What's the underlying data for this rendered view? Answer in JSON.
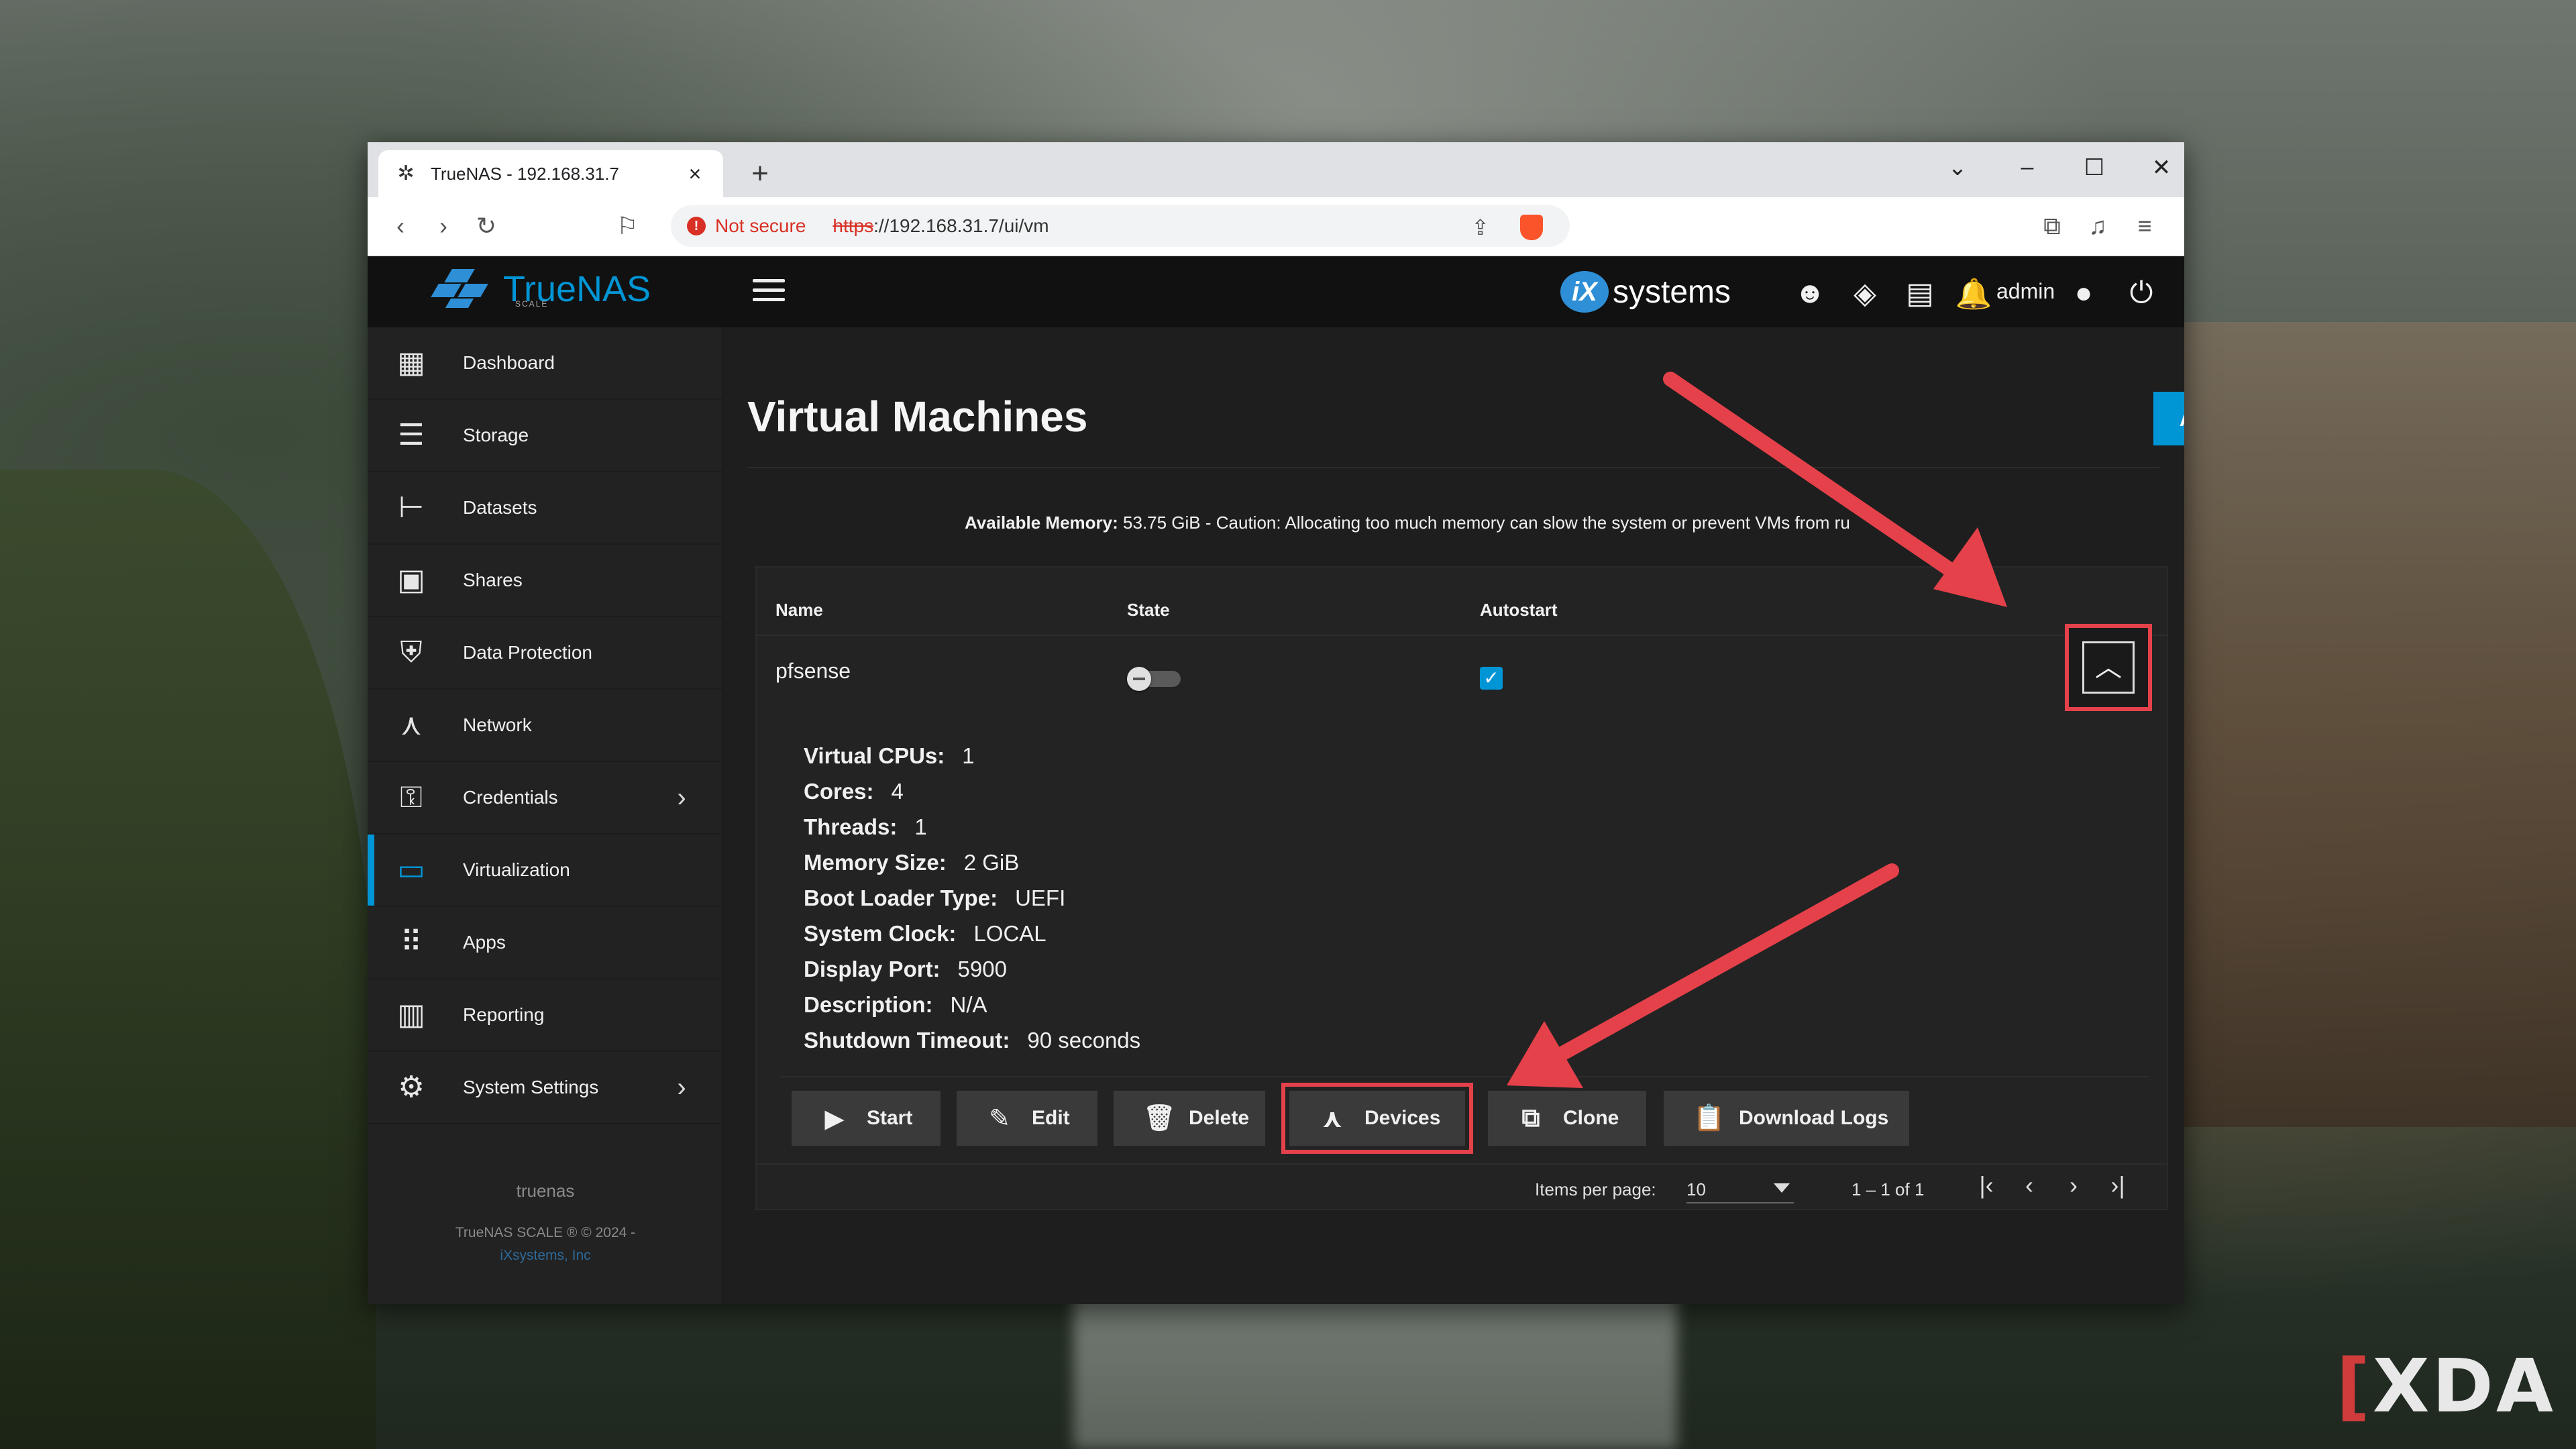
{
  "browser": {
    "tab_title": "TrueNAS - 192.168.31.7",
    "not_secure": "Not secure",
    "url_scheme": "https",
    "url_rest": "://192.168.31.7/ui/vm"
  },
  "brand": {
    "name": "TrueNAS",
    "edition": "SCALE"
  },
  "topbar": {
    "vendor": "systems",
    "vendor_mark": "iX",
    "user": "admin"
  },
  "sidebar": {
    "items": [
      {
        "label": "Dashboard",
        "icon": "dashboard-icon"
      },
      {
        "label": "Storage",
        "icon": "storage-icon"
      },
      {
        "label": "Datasets",
        "icon": "datasets-icon"
      },
      {
        "label": "Shares",
        "icon": "shares-icon"
      },
      {
        "label": "Data Protection",
        "icon": "shield-icon"
      },
      {
        "label": "Network",
        "icon": "network-icon"
      },
      {
        "label": "Credentials",
        "icon": "key-icon"
      },
      {
        "label": "Virtualization",
        "icon": "laptop-icon"
      },
      {
        "label": "Apps",
        "icon": "apps-grid-icon"
      },
      {
        "label": "Reporting",
        "icon": "chart-icon"
      },
      {
        "label": "System Settings",
        "icon": "gear-icon"
      }
    ],
    "hostname": "truenas",
    "copyright": "TrueNAS SCALE ® © 2024 -",
    "vendor_link": "iXsystems, Inc"
  },
  "main": {
    "title": "Virtual Machines",
    "add_label": "Add",
    "memory_label": "Available Memory:",
    "memory_text": " 53.75 GiB - Caution: Allocating too much memory can slow the system or prevent VMs from ru",
    "columns": {
      "name": "Name",
      "state": "State",
      "autostart": "Autostart"
    },
    "vm": {
      "name": "pfsense",
      "running": false,
      "autostart": true,
      "details": [
        {
          "k": "Virtual CPUs:",
          "v": "1"
        },
        {
          "k": "Cores:",
          "v": "4"
        },
        {
          "k": "Threads:",
          "v": "1"
        },
        {
          "k": "Memory Size:",
          "v": "2 GiB"
        },
        {
          "k": "Boot Loader Type:",
          "v": "UEFI"
        },
        {
          "k": "System Clock:",
          "v": "LOCAL"
        },
        {
          "k": "Display Port:",
          "v": "5900"
        },
        {
          "k": "Description:",
          "v": "N/A"
        },
        {
          "k": "Shutdown Timeout:",
          "v": "90 seconds"
        }
      ]
    },
    "actions": {
      "start": "Start",
      "edit": "Edit",
      "delete": "Delete",
      "devices": "Devices",
      "clone": "Clone",
      "download_logs": "Download Logs"
    },
    "pager": {
      "label": "Items per page:",
      "per_page": "10",
      "range": "1 – 1 of 1"
    }
  },
  "watermark": {
    "text": "XDA",
    "accent": "#d03c3c"
  },
  "colors": {
    "accent": "#0095d5",
    "highlight": "#e5414a"
  }
}
